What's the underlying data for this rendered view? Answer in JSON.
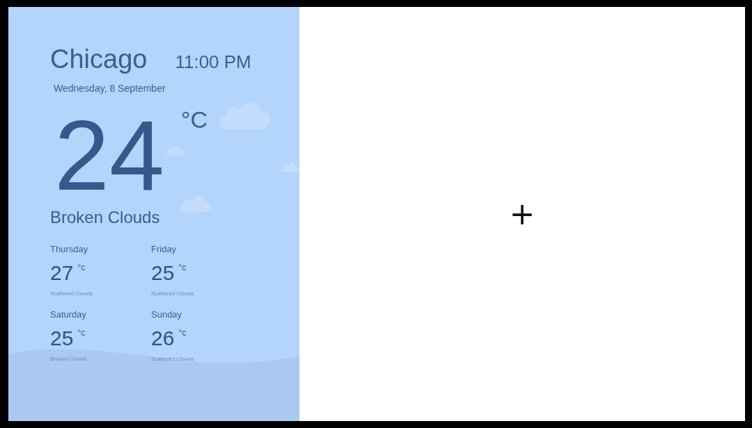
{
  "city": "Chicago",
  "time": "11:00 PM",
  "date": "Wednesday, 8 September",
  "current": {
    "temperature": "24",
    "unit": "°C",
    "condition": "Broken Clouds"
  },
  "forecast": [
    {
      "day": "Thursday",
      "temperature": "27",
      "unit": "°c",
      "condition": "Scattered Clouds"
    },
    {
      "day": "Friday",
      "temperature": "25",
      "unit": "°c",
      "condition": "Scattered Clouds"
    },
    {
      "day": "Saturday",
      "temperature": "25",
      "unit": "°c",
      "condition": "Broken Clouds"
    },
    {
      "day": "Sunday",
      "temperature": "26",
      "unit": "°c",
      "condition": "Scattered Clouds"
    }
  ],
  "add_button": {
    "label": "+"
  }
}
